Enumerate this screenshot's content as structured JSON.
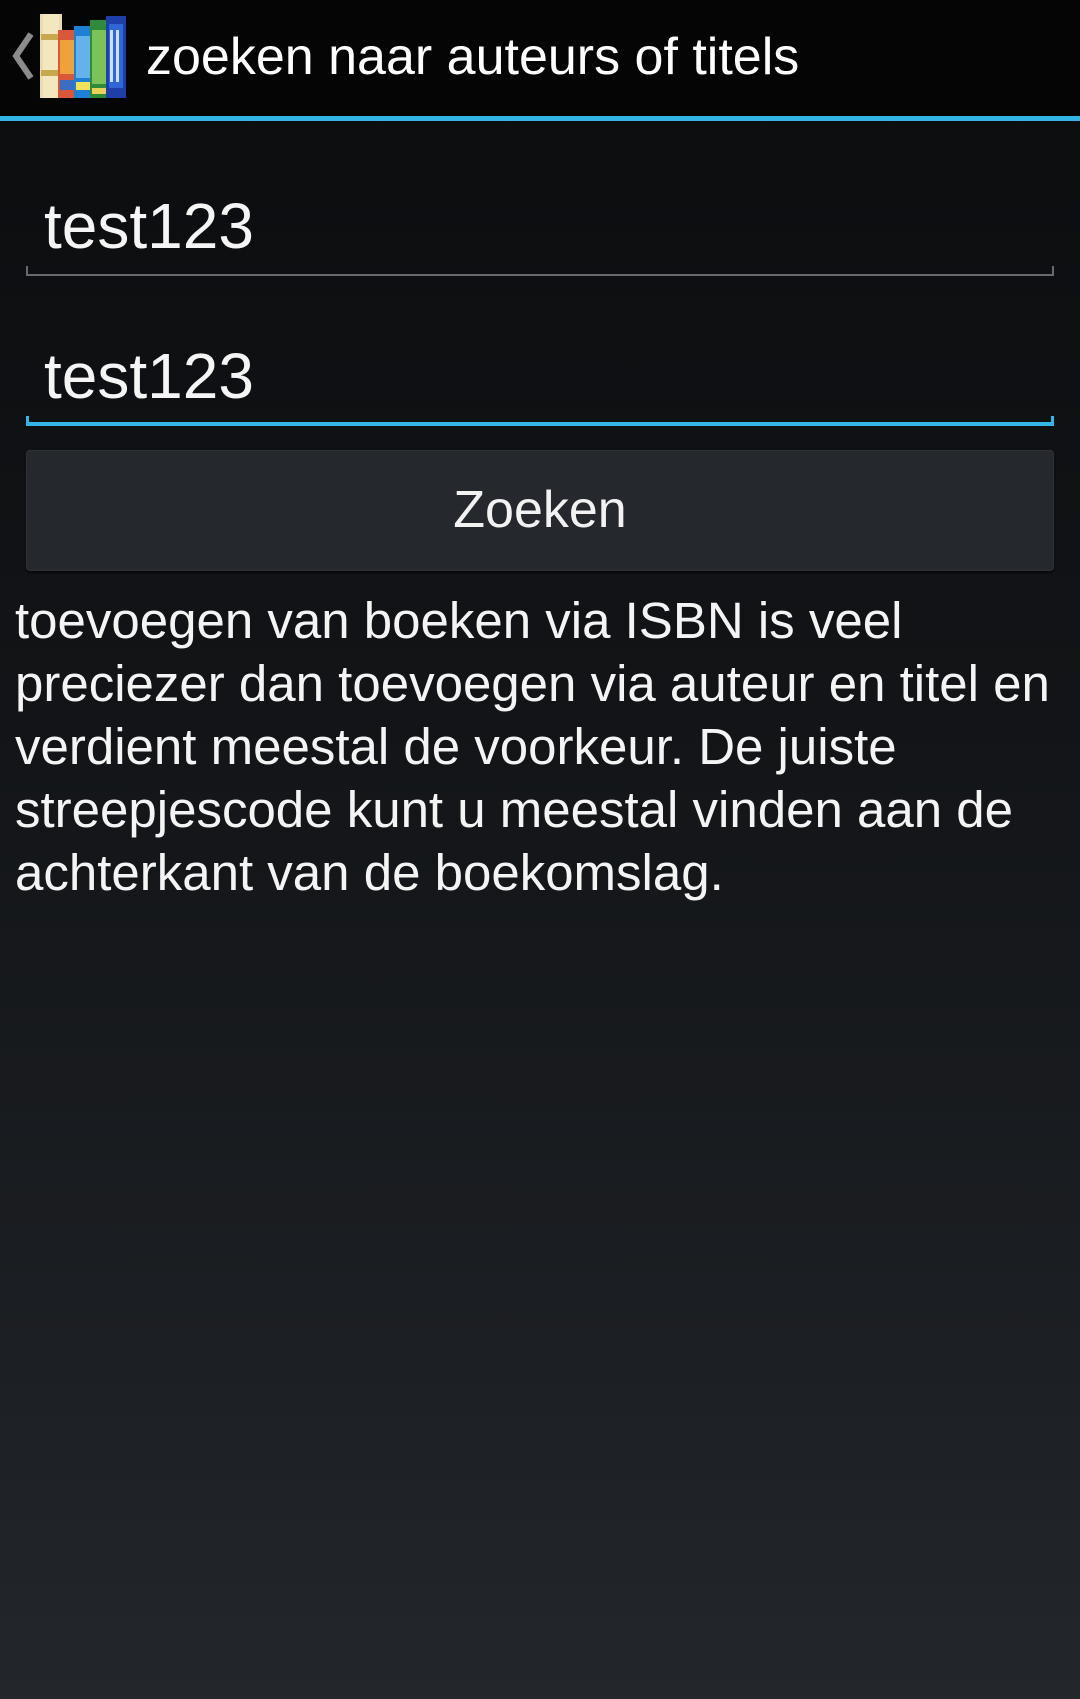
{
  "action_bar": {
    "title": "zoeken naar auteurs of titels",
    "up_icon": "chevron-left-icon",
    "app_icon": "books-app-icon",
    "accent_color": "#33b5e5"
  },
  "form": {
    "author_value": "test123",
    "title_value": "test123",
    "search_label": "Zoeken"
  },
  "info": {
    "text": "toevoegen van boeken via ISBN is veel preciezer dan toevoegen via auteur en titel en verdient meestal de voorkeur. De juiste streepjescode kunt u meestal vinden aan de achterkant van de boekomslag."
  }
}
